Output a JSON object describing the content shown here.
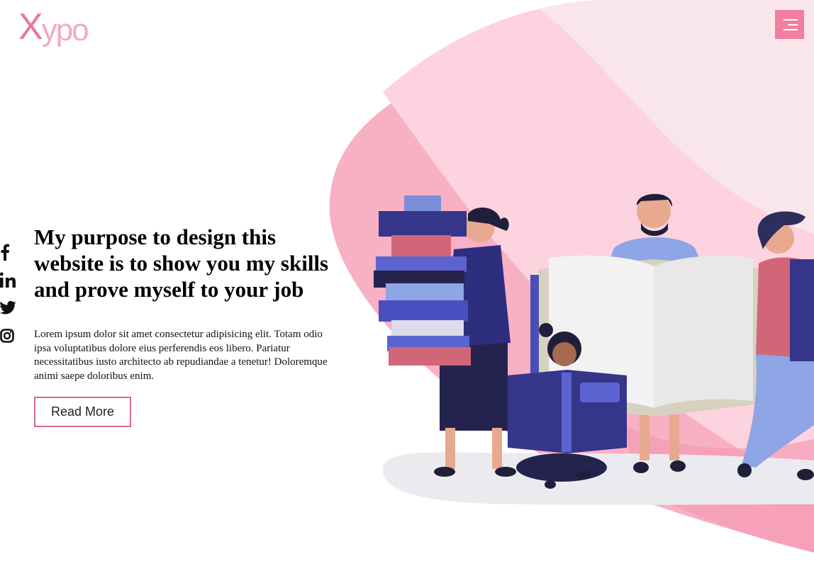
{
  "logo": {
    "first_letter": "X",
    "rest": "ypo"
  },
  "menu": {
    "icon": "hamburger-menu-icon"
  },
  "social": [
    {
      "name": "facebook",
      "icon": "facebook-icon"
    },
    {
      "name": "linkedin",
      "icon": "linkedin-icon"
    },
    {
      "name": "twitter",
      "icon": "twitter-icon"
    },
    {
      "name": "instagram",
      "icon": "instagram-icon"
    }
  ],
  "hero": {
    "title": "My purpose to design this website is to show you my skills and prove myself to your job",
    "body": "Lorem ipsum dolor sit amet consectetur adipisicing elit. Totam odio ipsa voluptatibus dolore eius perferendis eos libero. Pariatur necessitatibus iusto architecto ab repudiandae a tenetur! Doloremque animi saepe doloribus enim.",
    "button_label": "Read More"
  },
  "colors": {
    "accent": "#f07fa0",
    "button_border": "#d86a84",
    "blob_light": "#fcd3de",
    "blob_mid": "#f7b0c4",
    "blob_pale": "#f9e6ec",
    "navy": "#2e2e6e",
    "blue": "#4b4fb5"
  },
  "illustration": {
    "subject": "people-with-books-illustration"
  }
}
